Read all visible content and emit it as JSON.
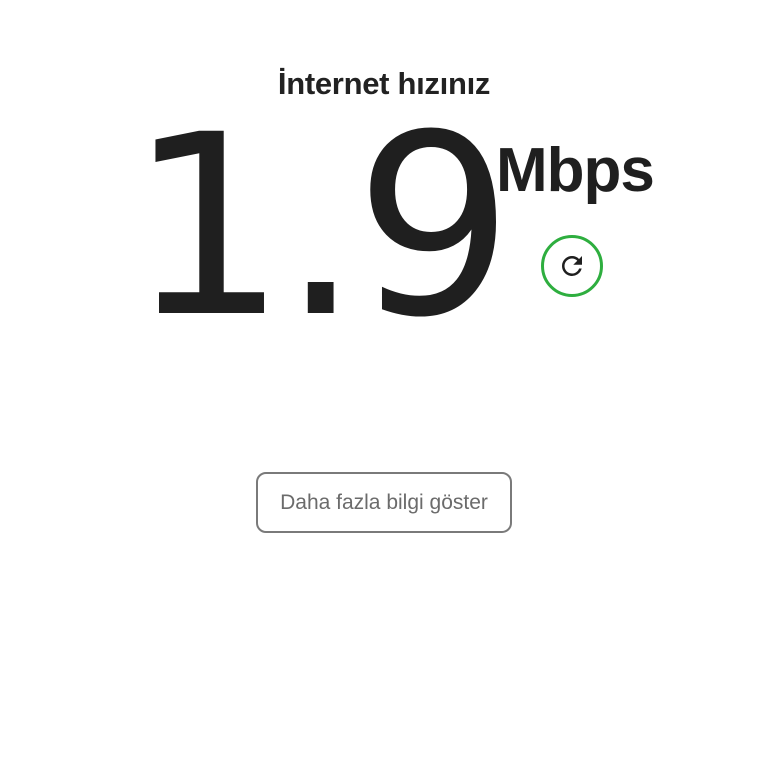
{
  "header": {
    "title": "İnternet hızınız"
  },
  "speed": {
    "value": "1.9",
    "unit": "Mbps"
  },
  "actions": {
    "refresh_icon": "refresh-icon",
    "more_info_label": "Daha fazla bilgi göster"
  },
  "colors": {
    "accent": "#2eae3f",
    "text": "#1f1f1f",
    "button_border": "#7a7a7a",
    "button_text": "#6b6b6b",
    "background": "#ffffff"
  }
}
